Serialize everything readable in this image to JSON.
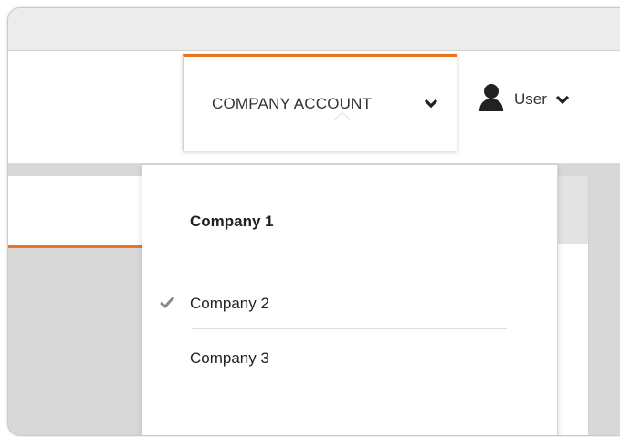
{
  "navbar": {
    "company_account_label": "COMPANY ACCOUNT",
    "user_label": "User",
    "accent_color": "#e97423"
  },
  "company_dropdown": {
    "items": [
      {
        "label": "Company 1",
        "style": "bold",
        "checked": false
      },
      {
        "label": "Company 2",
        "style": "normal",
        "checked": true
      },
      {
        "label": "Company 3",
        "style": "normal",
        "checked": false
      }
    ]
  },
  "icons": {
    "chevron": "chevron-down-icon",
    "user": "user-icon",
    "check": "checkmark-icon"
  }
}
